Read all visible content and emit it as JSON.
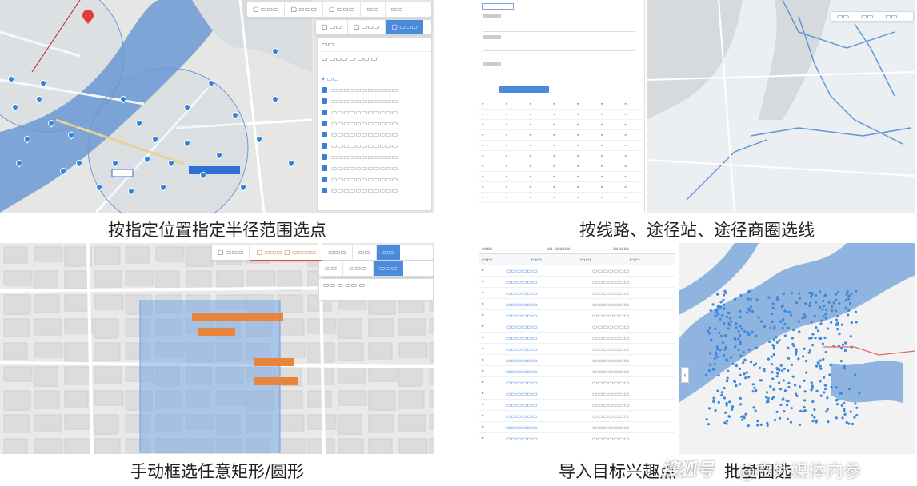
{
  "captions": {
    "top_left": "按指定位置指定半径范围选点",
    "top_right": "按线路、途径站、途径商圈选线",
    "bottom_left": "手动框选任意矩形/圆形",
    "bottom_right": "导入目标兴趣点",
    "bottom_right_tail": "批量圈选"
  },
  "watermarks": {
    "sohu": "搜狐号",
    "author": "@户外媒体内参"
  },
  "colors": {
    "water": "#7fa5d6",
    "map_bg": "#e8e8e8",
    "accent": "#4a8bdc",
    "selection": "#8fb8e8",
    "highlight_border": "#e0533b",
    "orange_tag": "#e8843b"
  }
}
